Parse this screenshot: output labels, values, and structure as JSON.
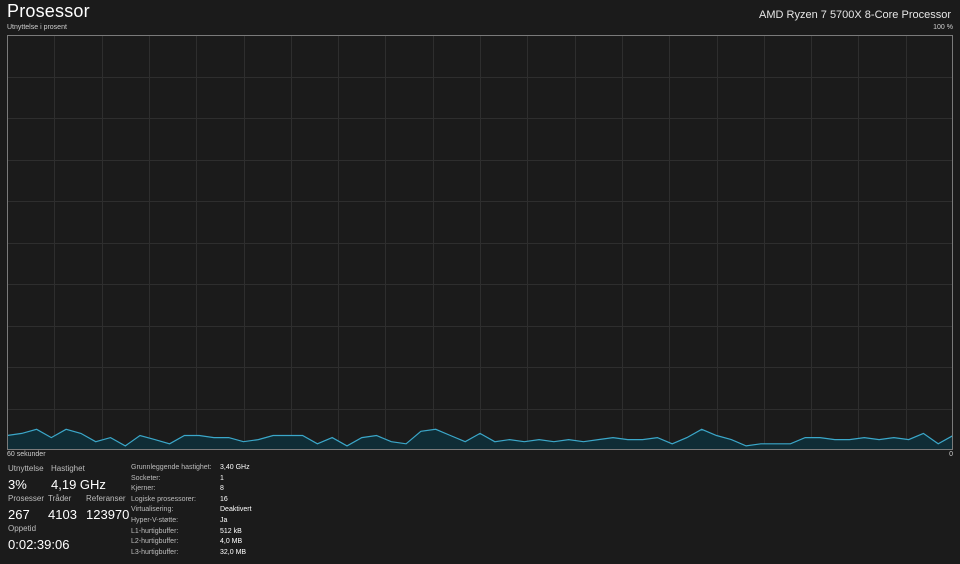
{
  "header": {
    "title": "Prosessor",
    "cpu_name": "AMD Ryzen 7 5700X 8-Core Processor"
  },
  "graph": {
    "y_label": "Utnyttelse i prosent",
    "y_max_label": "100 %",
    "x_label": "60 sekunder",
    "x_min_label": "0",
    "line_color": "#3ba7c9",
    "fill_color": "#0f2d36",
    "grid_color": "#2e2e2e"
  },
  "stats": {
    "utilization": {
      "label": "Utnyttelse",
      "value": "3%"
    },
    "speed": {
      "label": "Hastighet",
      "value": "4,19 GHz"
    },
    "processes": {
      "label": "Prosesser",
      "value": "267"
    },
    "threads": {
      "label": "Tråder",
      "value": "4103"
    },
    "handles": {
      "label": "Referanser",
      "value": "123970"
    },
    "uptime": {
      "label": "Oppetid",
      "value": "0:02:39:06"
    }
  },
  "specs": [
    {
      "key": "Grunnleggende hastighet:",
      "value": "3,40 GHz"
    },
    {
      "key": "Socketer:",
      "value": "1"
    },
    {
      "key": "Kjerner:",
      "value": "8"
    },
    {
      "key": "Logiske prosessorer:",
      "value": "16"
    },
    {
      "key": "Virtualisering:",
      "value": "Deaktivert"
    },
    {
      "key": "Hyper-V-støtte:",
      "value": "Ja"
    },
    {
      "key": "L1-hurtigbuffer:",
      "value": "512 kB"
    },
    {
      "key": "L2-hurtigbuffer:",
      "value": "4,0 MB"
    },
    {
      "key": "L3-hurtigbuffer:",
      "value": "32,0 MB"
    }
  ],
  "chart_data": {
    "type": "area",
    "ylim": [
      0,
      100
    ],
    "values": [
      3.5,
      4,
      5,
      3,
      5,
      4,
      2,
      3,
      1,
      3.5,
      2.5,
      1.5,
      3.5,
      3.5,
      3,
      3,
      2,
      2.5,
      3.5,
      3.5,
      3.5,
      1.5,
      3,
      1,
      3,
      3.5,
      2,
      1.5,
      4.5,
      5,
      3.5,
      2,
      4,
      2,
      2.5,
      2,
      2.5,
      2,
      2.5,
      2,
      2.5,
      3,
      2.5,
      2.5,
      3,
      1.5,
      3,
      5,
      3.5,
      2.5,
      1,
      1.5,
      1.5,
      1.5,
      3,
      3,
      2.5,
      2.5,
      3,
      2.5,
      3,
      2.5,
      4,
      1.5,
      3.5
    ]
  }
}
